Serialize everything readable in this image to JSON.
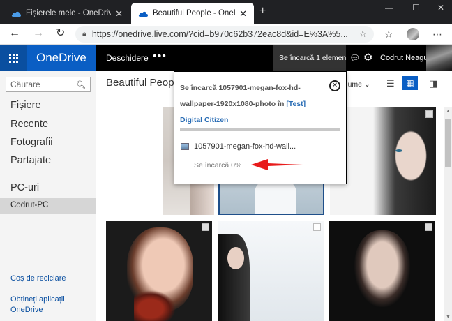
{
  "browser": {
    "tabs": [
      {
        "title": "Fișierele mele - OneDrive",
        "active": false
      },
      {
        "title": "Beautiful People - OneDrive",
        "active": true
      }
    ],
    "url": "https://onedrive.live.com/?cid=b970c62b372eac8d&id=E%3A%5..."
  },
  "header": {
    "brand": "OneDrive",
    "open_label": "Deschidere",
    "more_label": "•••",
    "upload_status": "Se încarcă 1 element...",
    "user_name": "Codrut Neagu"
  },
  "sidebar": {
    "search_placeholder": "Căutare",
    "items": [
      {
        "label": "Fișiere"
      },
      {
        "label": "Recente"
      },
      {
        "label": "Fotografii"
      },
      {
        "label": "Partajate"
      }
    ],
    "pcs_label": "PC-uri",
    "pc_item": "Codrut-PC",
    "recycle_label": "Coș de reciclare",
    "get_apps_line1": "Obțineți aplicații",
    "get_apps_line2": "OneDrive"
  },
  "content": {
    "folder_title": "Beautiful Peop",
    "sort_label": "Nume"
  },
  "upload_popup": {
    "message_prefix": "Se încarcă 1057901-megan-fox-hd-wallpaper-1920x1080-photo în",
    "message_link": "[Test] Digital Citizen",
    "file_name": "1057901-megan-fox-hd-wall...",
    "progress_text": "Se încarcă 0%",
    "progress_fraction": 0
  },
  "colors": {
    "accent": "#0a5ec4",
    "waffle": "#0a4fa0",
    "header_bg": "#000000",
    "annotation_arrow": "#e81b1b"
  }
}
